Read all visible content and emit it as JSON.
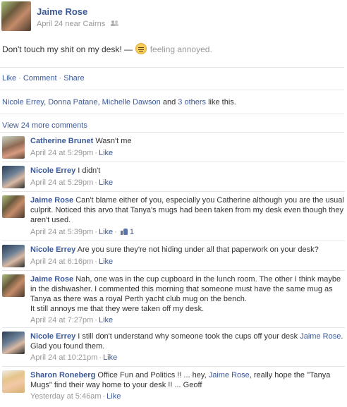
{
  "post": {
    "author": "Jaime Rose",
    "date": "April 24",
    "location_prefix": "near",
    "location": "Cairns",
    "status_text": "Don't touch my shit on my desk! —",
    "feeling": "feeling annoyed.",
    "feeling_icon": "annoyed-emoji-icon",
    "audience_icon": "friends-icon"
  },
  "actions": {
    "like": "Like",
    "comment": "Comment",
    "share": "Share",
    "sep": "·"
  },
  "likers": {
    "names": "Nicole Errey, Donna Patane, Michelle Dawson",
    "and": "and",
    "others": "3 others",
    "suffix": "like this."
  },
  "view_more": "View 24 more comments",
  "comments": [
    {
      "name": "Catherine Brunet",
      "text": "Wasn't me",
      "time": "April 24 at 5:29pm",
      "like": "Like"
    },
    {
      "name": "Nicole Errey",
      "text": "I didn't",
      "time": "April 24 at 5:29pm",
      "like": "Like"
    },
    {
      "name": "Jaime Rose",
      "text": "Can't blame either of you, especially you Catherine although you are the usual culprit. Noticed this arvo that Tanya's mugs had been taken from my desk even though they aren't used.",
      "time": "April 24 at 5:39pm",
      "like": "Like",
      "like_count": "1"
    },
    {
      "name": "Nicole Errey",
      "text": "Are you sure they're not hiding under all that paperwork on your desk?",
      "time": "April 24 at 6:16pm",
      "like": "Like"
    },
    {
      "name": "Jaime Rose",
      "text": "Nah, one was in the cup cupboard in the lunch room. The other I think maybe in the dishwasher. I commented this morning that someone must have the same mug as Tanya as there was a royal Perth yacht club mug on the bench.",
      "text2": "It still annoys me that they were taken off my desk.",
      "time": "April 24 at 7:27pm",
      "like": "Like"
    },
    {
      "name": "Nicole Errey",
      "text": "I still don't understand why someone took the cups off your desk",
      "mention": "Jaime Rose",
      "text_after": ". Glad you found them.",
      "time": "April 24 at 10:21pm",
      "like": "Like"
    },
    {
      "name": "Sharon Roneberg",
      "text": "Office Fun and Politics !! ... hey,",
      "mention": "Jaime Rose",
      "text_after": ", really hope the \"Tanya Mugs\" find their way home to your desk !! ... Geoff",
      "time": "Yesterday at 5:46am",
      "like": "Like"
    }
  ],
  "colors": {
    "link": "#3b5998",
    "meta": "#999999",
    "text": "#333333",
    "divider": "#e5e5e5"
  }
}
